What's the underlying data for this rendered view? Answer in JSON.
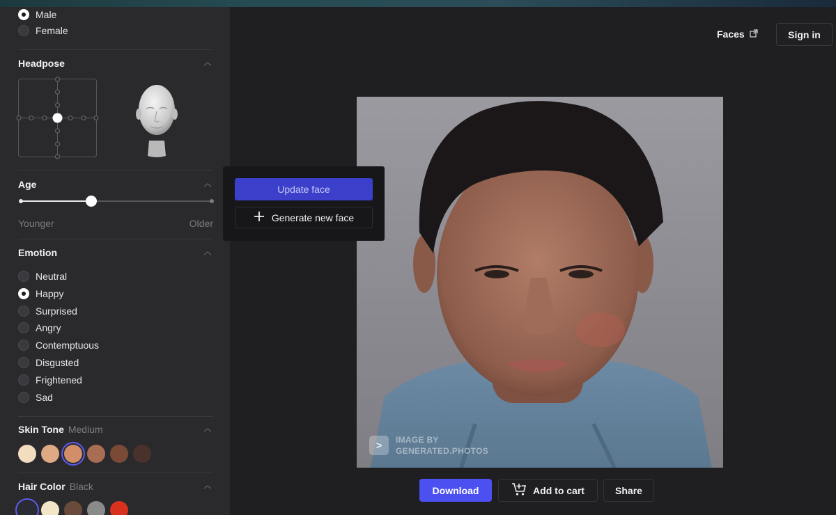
{
  "gender": {
    "options": [
      {
        "label": "Male",
        "selected": true
      },
      {
        "label": "Female",
        "selected": false
      }
    ]
  },
  "headpose": {
    "title": "Headpose"
  },
  "age": {
    "title": "Age",
    "value_fraction": 0.37,
    "min_label": "Younger",
    "max_label": "Older"
  },
  "emotion": {
    "title": "Emotion",
    "options": [
      {
        "label": "Neutral",
        "selected": false
      },
      {
        "label": "Happy",
        "selected": true
      },
      {
        "label": "Surprised",
        "selected": false
      },
      {
        "label": "Angry",
        "selected": false
      },
      {
        "label": "Contemptuous",
        "selected": false
      },
      {
        "label": "Disgusted",
        "selected": false
      },
      {
        "label": "Frightened",
        "selected": false
      },
      {
        "label": "Sad",
        "selected": false
      }
    ]
  },
  "skin_tone": {
    "title": "Skin Tone",
    "current": "Medium",
    "swatches": [
      "#f2ddbe",
      "#dfa985",
      "#d28e69",
      "#a86d53",
      "#7a4a36",
      "#4a322c"
    ],
    "selected_index": 2
  },
  "hair_color": {
    "title": "Hair Color",
    "current": "Black",
    "swatches": [
      "#2b2b33",
      "#f3e6c6",
      "#6a4a3b",
      "#8a8a8a",
      "#d8321f"
    ],
    "selected_index": 0
  },
  "popup": {
    "update_label": "Update face",
    "generate_label": "Generate new face"
  },
  "header": {
    "faces_link": "Faces",
    "signin_label": "Sign in"
  },
  "watermark": {
    "icon": ">",
    "line1": "IMAGE BY",
    "line2": "GENERATED.PHOTOS"
  },
  "actions": {
    "download_label": "Download",
    "cart_label": "Add to cart",
    "share_label": "Share"
  },
  "colors": {
    "accent": "#4d50f0",
    "sidebar_bg": "#2a2a2d",
    "main_bg": "#1f1f21"
  }
}
